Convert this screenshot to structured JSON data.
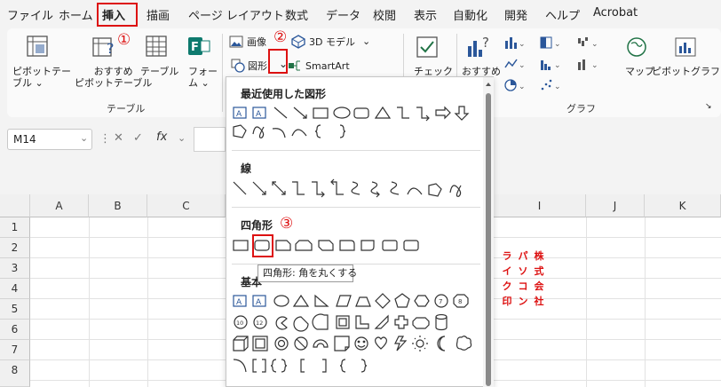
{
  "menu": {
    "tabs": [
      "ファイル",
      "ホーム",
      "挿入",
      "描画",
      "ページ レイアウト",
      "数式",
      "データ",
      "校閲",
      "表示",
      "自動化",
      "開発",
      "ヘルプ",
      "Acrobat"
    ],
    "active_tab": "挿入"
  },
  "annotations": {
    "step1": "①",
    "step2": "②",
    "step3": "③"
  },
  "ribbon": {
    "pivot_table": [
      "ピボットテー",
      "ブル ⌄"
    ],
    "recommended_pivot": [
      "おすすめ",
      "ピボットテーブル"
    ],
    "table": "テーブル",
    "forms": [
      "フォー",
      "ム ⌄"
    ],
    "group_table": "テーブル",
    "image": "画像",
    "model3d": "3D モデル",
    "shapes": "図形",
    "smartart": "SmartArt",
    "check": "チェック",
    "recommended_chart": "おすすめ",
    "map": "マップ",
    "pivot_chart": "ピボットグラフ",
    "group_graph": "グラフ"
  },
  "formula_bar": {
    "name_box": "M14",
    "fx": "fx"
  },
  "grid": {
    "columns": [
      "A",
      "B",
      "C",
      "I",
      "J",
      "K"
    ],
    "rows": [
      "1",
      "2",
      "3",
      "4",
      "5",
      "6",
      "7",
      "8"
    ]
  },
  "vertical_text": [
    "ラ",
    "イ",
    "ク",
    "印",
    "パ",
    "ソ",
    "コ",
    "ン",
    "株",
    "式",
    "会",
    "社"
  ],
  "gallery": {
    "recent": "最近使用した図形",
    "lines": "線",
    "rectangles": "四角形",
    "basic": "基本",
    "tooltip": "四角形: 角を丸くする"
  },
  "colors": {
    "highlight": "#d11111",
    "accent": "#217346",
    "icon_blue": "#2b579a"
  }
}
